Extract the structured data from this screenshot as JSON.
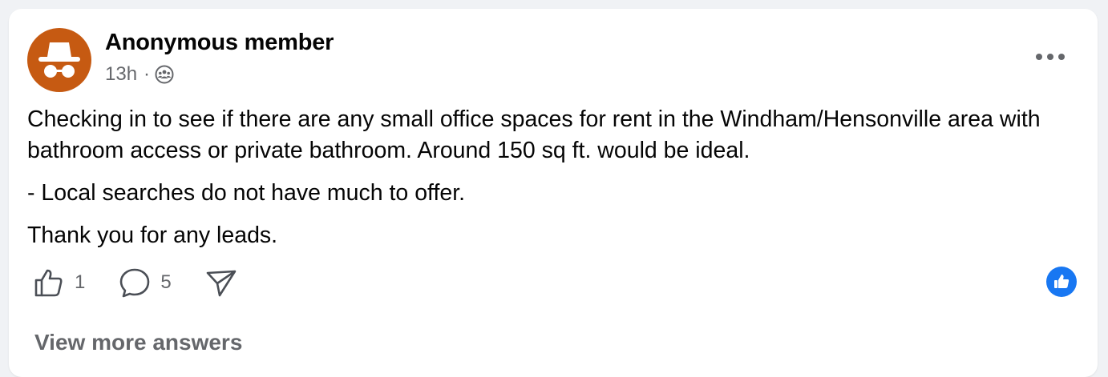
{
  "post": {
    "author": "Anonymous member",
    "time": "13h",
    "separator": "·",
    "audience_icon": "group-icon",
    "body": [
      "Checking in to see if there are any small office spaces for rent in the Windham/Hensonville area with bathroom access or private bathroom.  Around 150 sq ft. would be ideal.",
      "- Local searches do not have much to offer.",
      "Thank you for any leads."
    ],
    "reactions": {
      "like_count": "1",
      "comment_count": "5"
    },
    "view_more": "View more answers"
  },
  "colors": {
    "avatar_bg": "#c65a12",
    "brand_blue": "#1877f2",
    "secondary_text": "#65676b",
    "primary_text": "#050505"
  }
}
